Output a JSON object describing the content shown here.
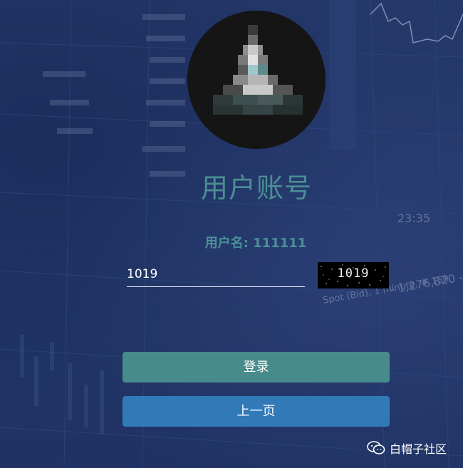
{
  "page": {
    "title": "用户账号"
  },
  "account": {
    "username_label": "用户名: 111111"
  },
  "captcha_input": {
    "value": "1019"
  },
  "captcha": {
    "text": "1019"
  },
  "buttons": {
    "login_label": "登录",
    "back_label": "上一页"
  },
  "watermark": {
    "text": "白帽子社区",
    "icon": "wechat-icon"
  },
  "background": {
    "readouts": [
      "23:35",
      "- 1,276,820 -",
      "Spot (Bid), 1 minute, # 159"
    ]
  },
  "colors": {
    "title": "#4a8f93",
    "login_button": "#478b8b",
    "back_button": "#3279b8",
    "background": "#233766"
  }
}
